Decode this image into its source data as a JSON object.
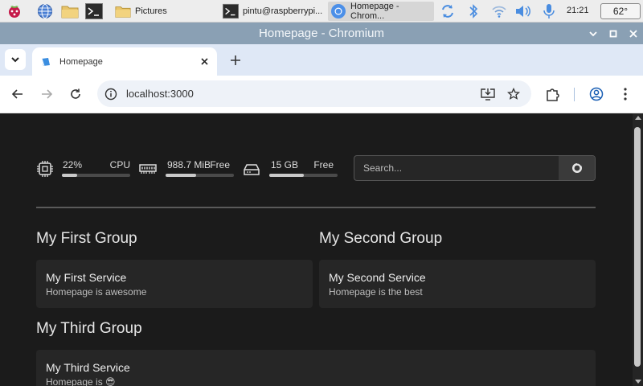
{
  "taskbar": {
    "tasks": [
      {
        "label": "Pictures"
      },
      {
        "label": "pintu@raspberrypi..."
      },
      {
        "label": "Homepage - Chrom..."
      }
    ],
    "clock": "21:21",
    "temperature": "62°"
  },
  "window": {
    "title": "Homepage - Chromium"
  },
  "browser": {
    "tab_title": "Homepage",
    "url": "localhost:3000"
  },
  "widgets": {
    "cpu": {
      "value": "22%",
      "label": "CPU",
      "level": 0.22
    },
    "memory": {
      "value": "988.7 MiB",
      "label": "Free",
      "level": 0.45
    },
    "disk": {
      "value": "15 GB",
      "label": "Free",
      "level": 0.5
    }
  },
  "search": {
    "placeholder": "Search..."
  },
  "groups": [
    {
      "title": "My First Group",
      "services": [
        {
          "name": "My First Service",
          "description": "Homepage is awesome"
        }
      ]
    },
    {
      "title": "My Second Group",
      "services": [
        {
          "name": "My Second Service",
          "description": "Homepage is the best"
        }
      ]
    },
    {
      "title": "My Third Group",
      "services": [
        {
          "name": "My Third Service",
          "description": "Homepage is 😎"
        }
      ]
    }
  ],
  "colors": {
    "page_bg": "#1b1b1b",
    "card_bg": "#262626",
    "titlebar": "#8aa0b4",
    "tabstrip": "#dfe8f6"
  }
}
